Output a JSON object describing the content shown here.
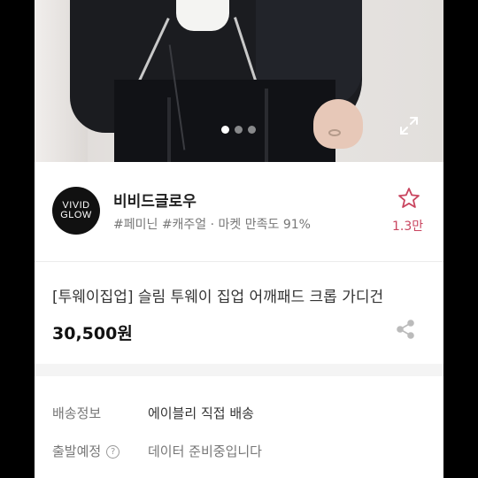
{
  "gallery": {
    "page_count": 3,
    "active_index": 0,
    "expand_icon": "expand-icon"
  },
  "seller": {
    "logo_text_top": "VIVID",
    "logo_text_bottom": "GLOW",
    "name": "비비드글로우",
    "tags": "#페미닌 #캐주얼 · 마켓 만족도 91%",
    "likes": "1.3만",
    "like_icon": "star-icon"
  },
  "product": {
    "title": "[투웨이집업] 슬림 투웨이 집업 어깨패드 크롭 가디건",
    "price": "30,500원",
    "share_icon": "share-icon"
  },
  "shipping": {
    "label": "배송정보",
    "value": "에이블리 직접 배송"
  },
  "departure": {
    "label": "출발예정",
    "help": "?",
    "value": "데이터 준비중입니다"
  },
  "colors": {
    "accent": "#c9455f",
    "text_muted": "#777777"
  }
}
